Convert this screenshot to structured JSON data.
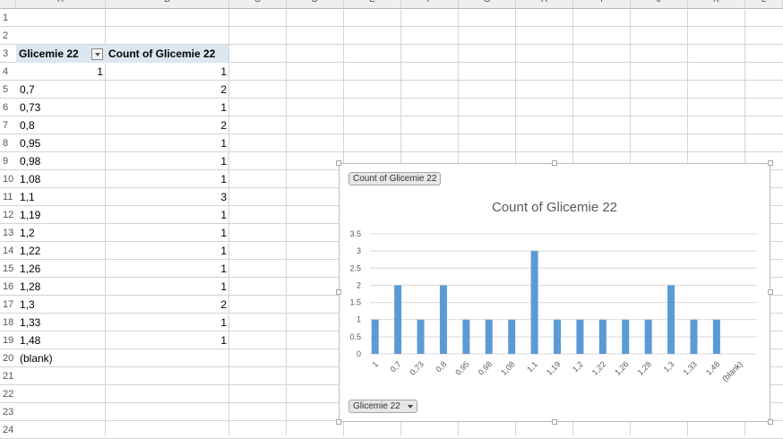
{
  "columns": [
    "A",
    "B",
    "C",
    "D",
    "E",
    "F",
    "G",
    "H",
    "I",
    "J",
    "K",
    "L"
  ],
  "rows": [
    "1",
    "2",
    "3",
    "4",
    "5",
    "6",
    "7",
    "8",
    "9",
    "10",
    "11",
    "12",
    "13",
    "14",
    "15",
    "16",
    "17",
    "18",
    "19",
    "20",
    "21",
    "22",
    "23",
    "24"
  ],
  "pivot": {
    "header_field": "Glicemie 22",
    "header_count": "Count of Glicemie 22",
    "entries": [
      {
        "label": "",
        "a_value": "1",
        "count": "1"
      },
      {
        "label": "0,7",
        "a_value": "",
        "count": "2"
      },
      {
        "label": "0,73",
        "a_value": "",
        "count": "1"
      },
      {
        "label": "0,8",
        "a_value": "",
        "count": "2"
      },
      {
        "label": "0,95",
        "a_value": "",
        "count": "1"
      },
      {
        "label": "0,98",
        "a_value": "",
        "count": "1"
      },
      {
        "label": "1,08",
        "a_value": "",
        "count": "1"
      },
      {
        "label": "1,1",
        "a_value": "",
        "count": "3"
      },
      {
        "label": "1,19",
        "a_value": "",
        "count": "1"
      },
      {
        "label": "1,2",
        "a_value": "",
        "count": "1"
      },
      {
        "label": "1,22",
        "a_value": "",
        "count": "1"
      },
      {
        "label": "1,26",
        "a_value": "",
        "count": "1"
      },
      {
        "label": "1,28",
        "a_value": "",
        "count": "1"
      },
      {
        "label": "1,3",
        "a_value": "",
        "count": "2"
      },
      {
        "label": "1,33",
        "a_value": "",
        "count": "1"
      },
      {
        "label": "1,48",
        "a_value": "",
        "count": "1"
      },
      {
        "label": "(blank)",
        "a_value": "",
        "count": ""
      }
    ]
  },
  "chart": {
    "values_button": "Count of Glicemie 22",
    "axis_button": "Glicemie 22"
  },
  "chart_data": {
    "type": "bar",
    "title": "Count of Glicemie 22",
    "categories": [
      "1",
      "0,7",
      "0,73",
      "0,8",
      "0,95",
      "0,98",
      "1,08",
      "1,1",
      "1,19",
      "1,2",
      "1,22",
      "1,26",
      "1,28",
      "1,3",
      "1,33",
      "1,48",
      "(blank)"
    ],
    "values": [
      1,
      2,
      1,
      2,
      1,
      1,
      1,
      3,
      1,
      1,
      1,
      1,
      1,
      2,
      1,
      1,
      null
    ],
    "yticks": [
      "0",
      "0.5",
      "1",
      "1.5",
      "2",
      "2.5",
      "3",
      "3.5"
    ],
    "ylim": [
      0,
      3.5
    ],
    "grid": true,
    "bar_color": "#5b9bd5"
  }
}
